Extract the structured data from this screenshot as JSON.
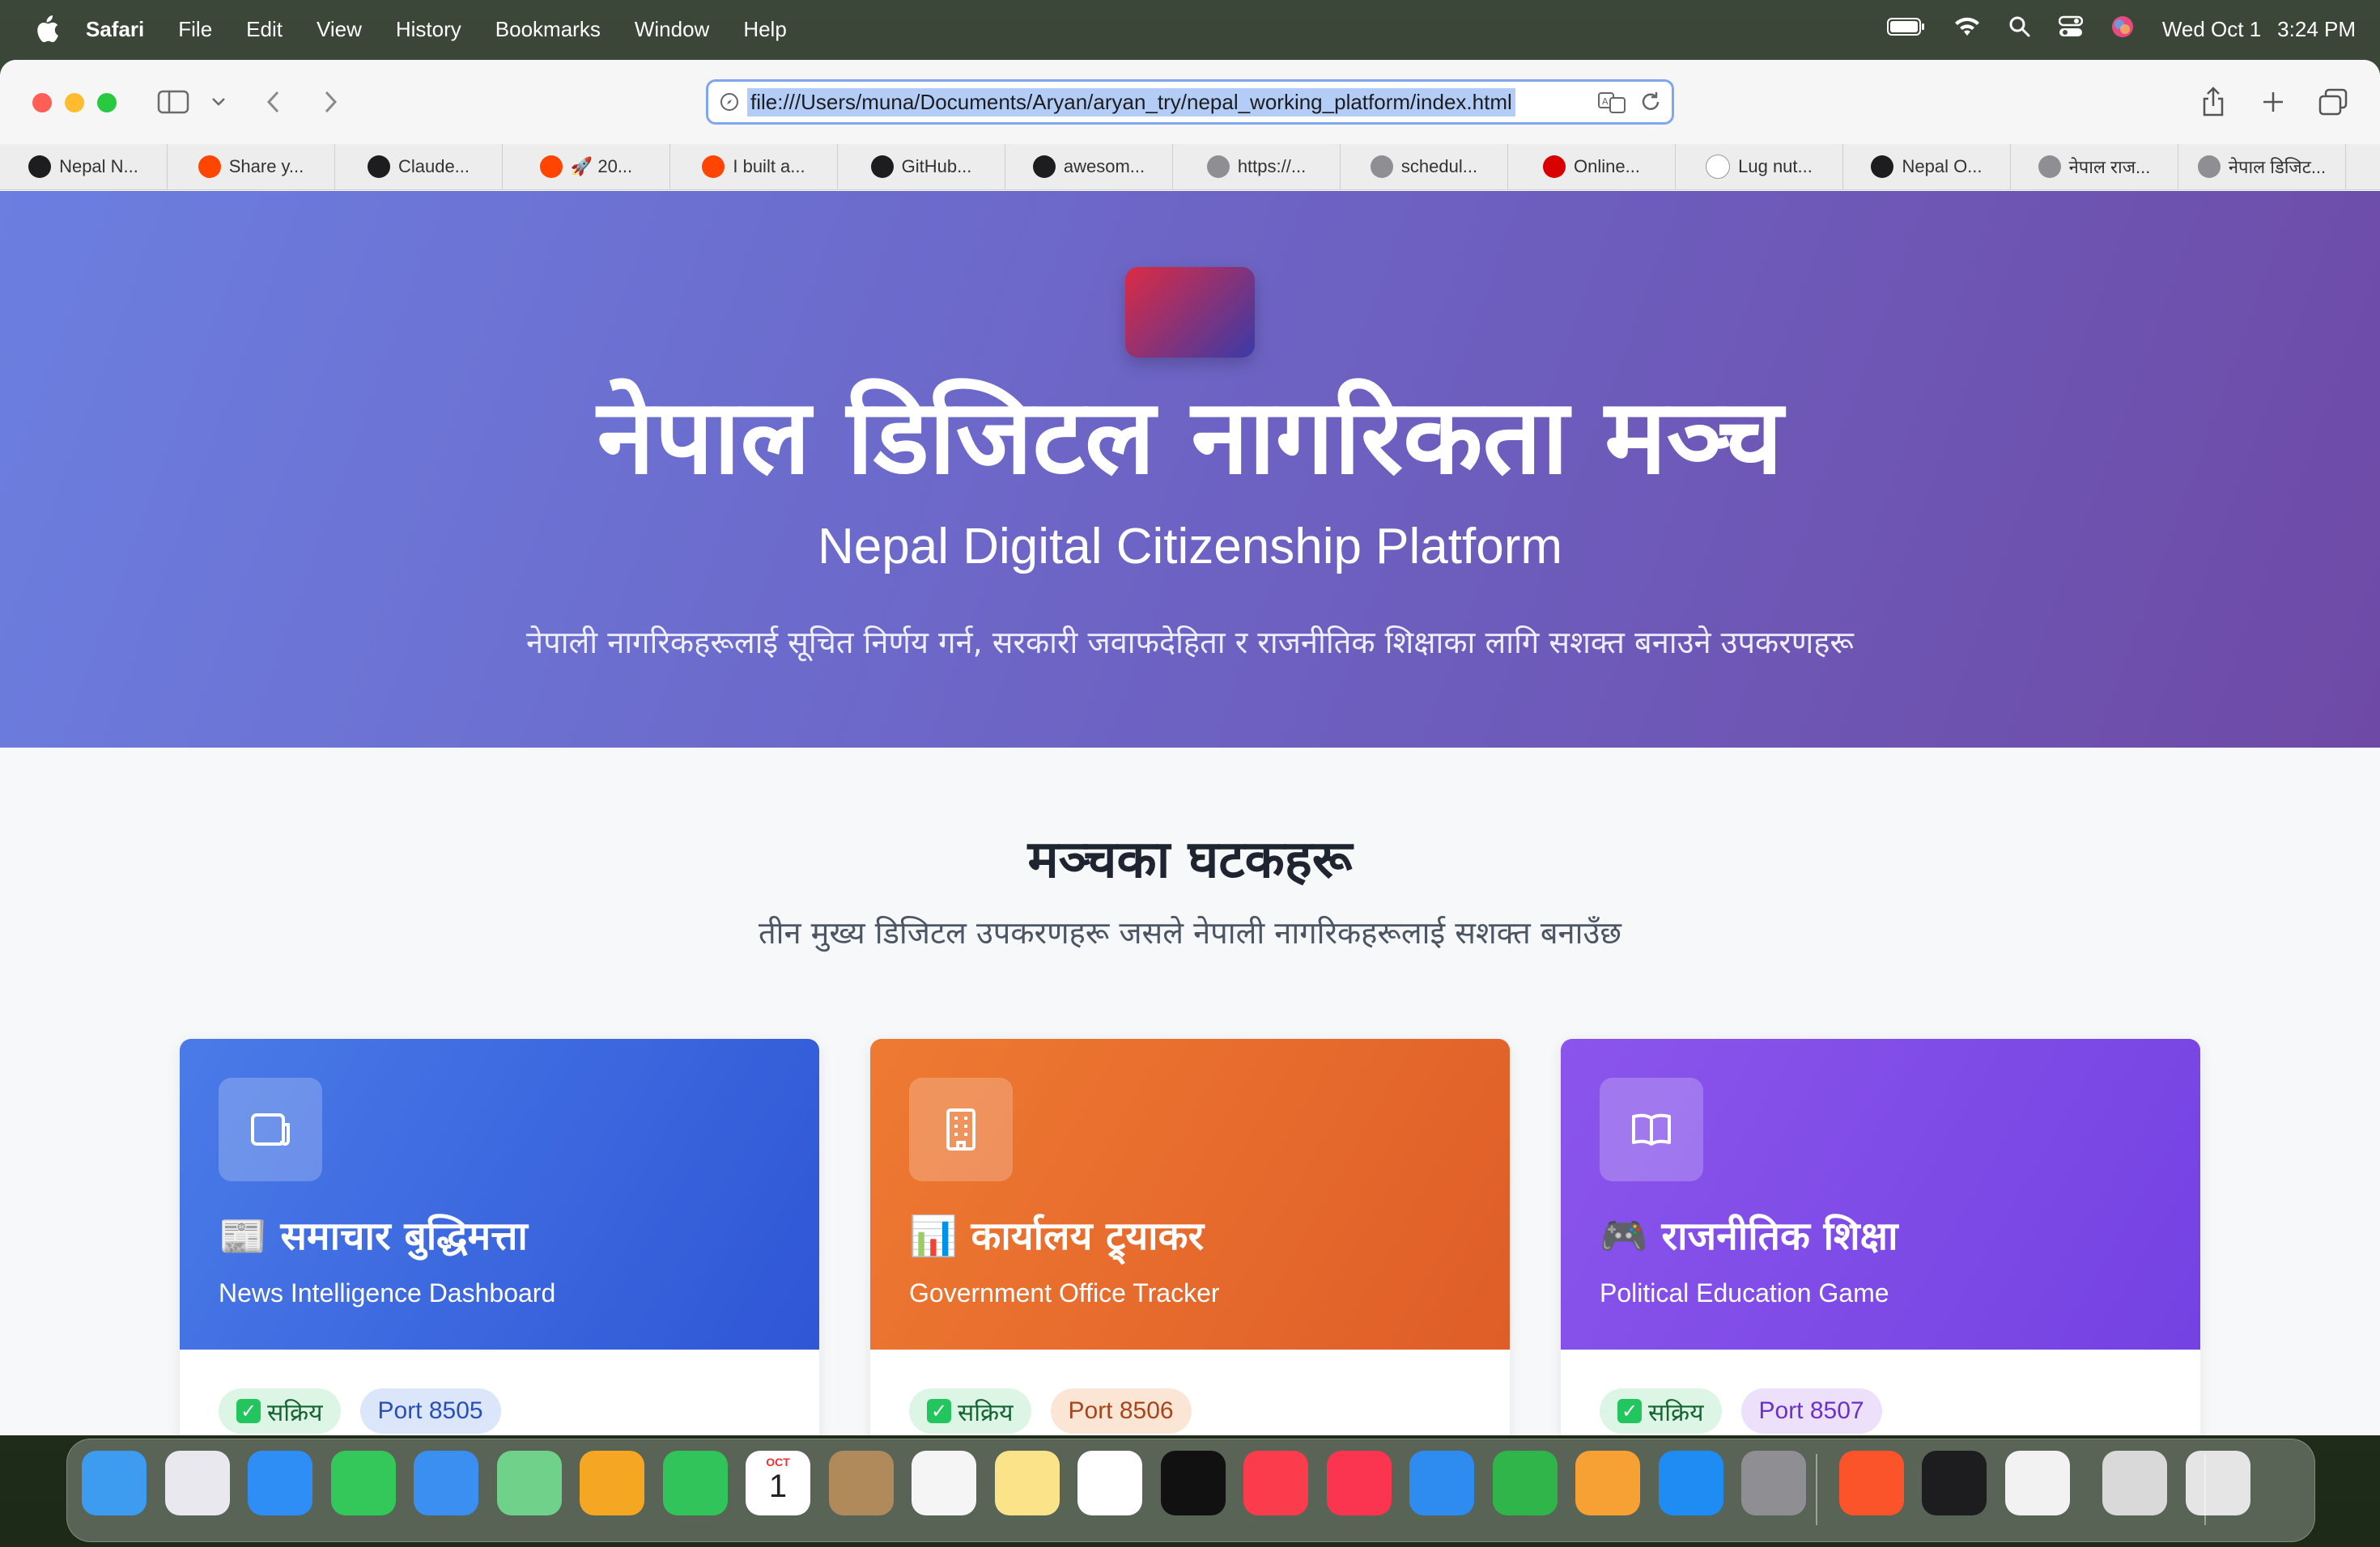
{
  "menubar": {
    "app_name": "Safari",
    "items": [
      "File",
      "Edit",
      "View",
      "History",
      "Bookmarks",
      "Window",
      "Help"
    ],
    "date": "Wed Oct 1",
    "time": "3:24 PM"
  },
  "browser": {
    "url": "file:///Users/muna/Documents/Aryan/aryan_try/nepal_working_platform/index.html",
    "bookmarks": [
      {
        "label": "Nepal N...",
        "icon": "crown-icon",
        "color": "#1d1d1f"
      },
      {
        "label": "Share y...",
        "icon": "reddit-icon",
        "color": "#ff4500"
      },
      {
        "label": "Claude...",
        "icon": "anthropic-icon",
        "color": "#1d1d1f"
      },
      {
        "label": "🚀 20...",
        "icon": "reddit-icon",
        "color": "#ff4500"
      },
      {
        "label": "I built a...",
        "icon": "reddit-icon",
        "color": "#ff4500"
      },
      {
        "label": "GitHub...",
        "icon": "github-icon",
        "color": "#1d1d1f"
      },
      {
        "label": "awesom...",
        "icon": "github-icon",
        "color": "#1d1d1f"
      },
      {
        "label": "https://...",
        "icon": "m-letter-icon",
        "color": "#8e8e93"
      },
      {
        "label": "schedul...",
        "icon": "g-letter-icon",
        "color": "#8e8e93"
      },
      {
        "label": "Online...",
        "icon": "flag-icon",
        "color": "#d90000"
      },
      {
        "label": "Lug nut...",
        "icon": "wikipedia-icon",
        "color": "#ffffff"
      },
      {
        "label": "Nepal O...",
        "icon": "crown-icon",
        "color": "#1d1d1f"
      },
      {
        "label": "नेपाल राज...",
        "icon": "l-letter-icon",
        "color": "#8e8e93"
      },
      {
        "label": "नेपाल डिजिट...",
        "icon": "compass-icon",
        "color": "#8e8e93"
      }
    ]
  },
  "hero": {
    "title": "नेपाल डिजिटल नागरिकता मञ्च",
    "subtitle": "Nepal Digital Citizenship Platform",
    "description": "नेपाली नागरिकहरूलाई सूचित निर्णय गर्न, सरकारी जवाफदेहिता र राजनीतिक शिक्षाका लागि सशक्त बनाउने उपकरणहरू"
  },
  "section": {
    "title": "मञ्चका घटकहरू",
    "subtitle": "तीन मुख्य डिजिटल उपकरणहरू जसले नेपाली नागरिकहरूलाई सशक्त बनाउँछ"
  },
  "cards": [
    {
      "title": "📰 समाचार बुद्धिमत्ता",
      "subtitle": "News Intelligence Dashboard",
      "status": "सक्रिय",
      "port": "Port 8505",
      "icon": "newspaper-icon",
      "color_from": "#4a7be8",
      "color_to": "#2f56d6",
      "port_bg": "#dbe6fb",
      "port_fg": "#2a4fb6"
    },
    {
      "title": "📊 कार्यालय ट्र्याकर",
      "subtitle": "Government Office Tracker",
      "status": "सक्रिय",
      "port": "Port 8506",
      "icon": "building-icon",
      "color_from": "#ee7a32",
      "color_to": "#df5d28",
      "port_bg": "#fbe6d6",
      "port_fg": "#a8461a"
    },
    {
      "title": "🎮 राजनीतिक शिक्षा",
      "subtitle": "Political Education Game",
      "status": "सक्रिय",
      "port": "Port 8507",
      "icon": "book-icon",
      "color_from": "#8b55ec",
      "color_to": "#7442e2",
      "port_bg": "#ece0fb",
      "port_fg": "#6a32c9"
    }
  ],
  "dock": {
    "apps": [
      {
        "name": "finder-icon",
        "color": "#3d9bf0"
      },
      {
        "name": "launchpad-icon",
        "color": "#e8e8ee"
      },
      {
        "name": "safari-icon",
        "color": "#2e8ef5"
      },
      {
        "name": "messages-icon",
        "color": "#34c759"
      },
      {
        "name": "mail-icon",
        "color": "#3b8ff0"
      },
      {
        "name": "maps-icon",
        "color": "#6fd18a"
      },
      {
        "name": "photos-icon",
        "color": "#f5a623"
      },
      {
        "name": "facetime-icon",
        "color": "#30c45a"
      },
      {
        "name": "calendar-icon",
        "color": "#ffffff"
      },
      {
        "name": "contacts-icon",
        "color": "#b08a5a"
      },
      {
        "name": "reminders-icon",
        "color": "#f5f5f5"
      },
      {
        "name": "notes-icon",
        "color": "#fbe38a"
      },
      {
        "name": "freeform-icon",
        "color": "#ffffff"
      },
      {
        "name": "appletv-icon",
        "color": "#111111"
      },
      {
        "name": "music-icon",
        "color": "#fa3c4c"
      },
      {
        "name": "news-icon",
        "color": "#fb3550"
      },
      {
        "name": "keynote-icon",
        "color": "#2e8cf0"
      },
      {
        "name": "numbers-icon",
        "color": "#2fb54a"
      },
      {
        "name": "pages-icon",
        "color": "#f7a033"
      },
      {
        "name": "appstore-icon",
        "color": "#1e8cf2"
      },
      {
        "name": "system-settings-icon",
        "color": "#8e8e93"
      },
      {
        "name": "brave-icon",
        "color": "#fb542b"
      },
      {
        "name": "terminal-icon",
        "color": "#1d1d1f"
      },
      {
        "name": "textedit-icon",
        "color": "#f2f2f2"
      },
      {
        "name": "downloads-icon",
        "color": "#d9d9d9"
      },
      {
        "name": "trash-icon",
        "color": "#e5e5e5"
      }
    ],
    "calendar_month": "OCT",
    "calendar_day": "1"
  }
}
